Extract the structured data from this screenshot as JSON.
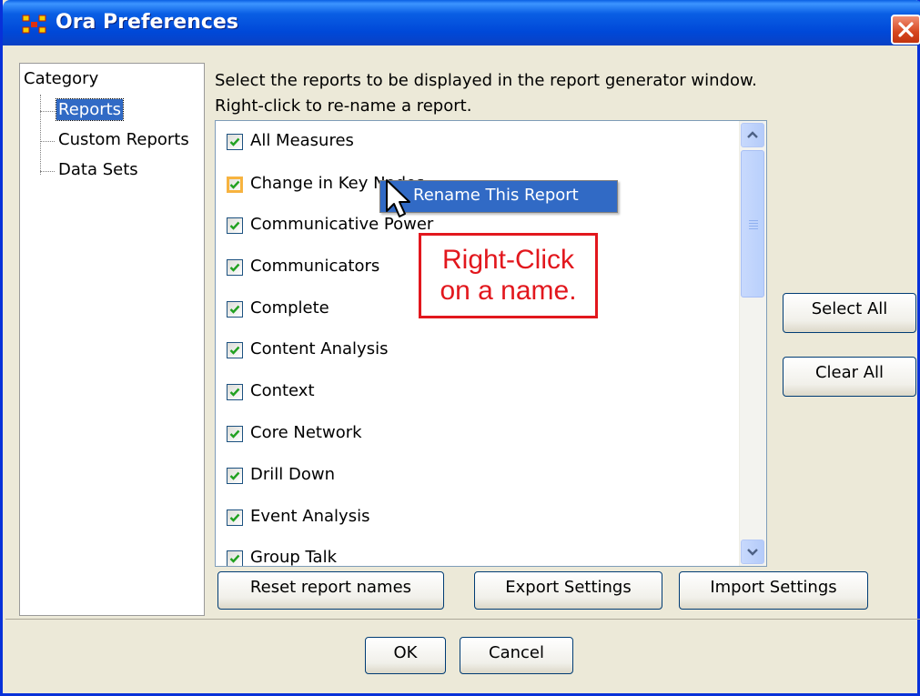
{
  "window": {
    "title": "Ora Preferences"
  },
  "colors": {
    "titlebar": "#0a5fe4",
    "selection": "#316ac5",
    "annotation": "#e2171d",
    "checkmark": "#21a121"
  },
  "tree": {
    "root_label": "Category",
    "items": [
      {
        "label": "Reports",
        "selected": true
      },
      {
        "label": "Custom Reports",
        "selected": false
      },
      {
        "label": "Data Sets",
        "selected": false
      }
    ]
  },
  "instructions": {
    "line1": "Select the reports to be displayed in the report generator window.",
    "line2": "Right-click to re-name a report."
  },
  "reports": [
    {
      "label": "All Measures",
      "checked": true
    },
    {
      "label": "Change in Key Nodes",
      "checked": true
    },
    {
      "label": "Communicative Power",
      "checked": true
    },
    {
      "label": "Communicators",
      "checked": true
    },
    {
      "label": "Complete",
      "checked": true
    },
    {
      "label": "Content Analysis",
      "checked": true
    },
    {
      "label": "Context",
      "checked": true
    },
    {
      "label": "Core Network",
      "checked": true
    },
    {
      "label": "Drill Down",
      "checked": true
    },
    {
      "label": "Event Analysis",
      "checked": true
    },
    {
      "label": "Group Talk",
      "checked": true
    }
  ],
  "context_menu": {
    "item": "Rename This Report"
  },
  "annotation": {
    "line1": "Right-Click",
    "line2": "on a name."
  },
  "side_buttons": {
    "select_all": "Select All",
    "clear_all": "Clear All"
  },
  "bottom_buttons": {
    "reset": "Reset report names",
    "export": "Export Settings",
    "import": "Import Settings"
  },
  "dialog_buttons": {
    "ok": "OK",
    "cancel": "Cancel"
  },
  "icons": {
    "app": "ora-app-icon",
    "close": "close-icon",
    "scroll_up": "chevron-up-icon",
    "scroll_down": "chevron-down-icon",
    "cursor": "mouse-pointer-icon"
  }
}
